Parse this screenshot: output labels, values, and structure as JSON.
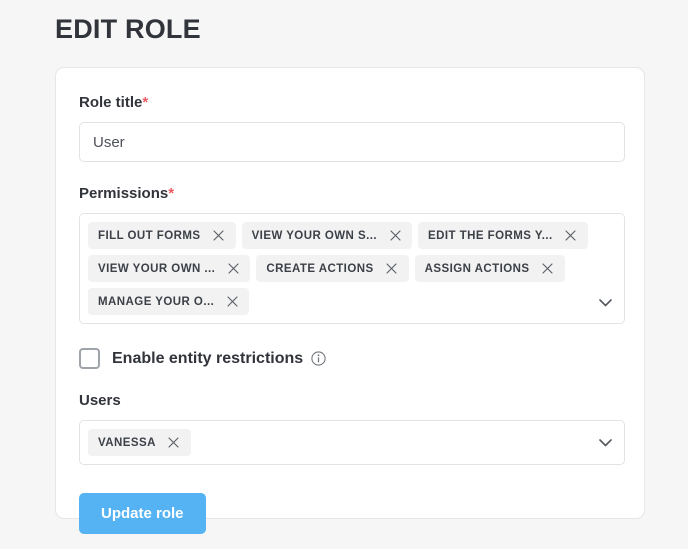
{
  "page": {
    "title": "EDIT ROLE",
    "background_color": "#f6f6f6"
  },
  "form": {
    "role_title": {
      "label": "Role title",
      "required_marker": "*",
      "value": "User",
      "placeholder": "Role title"
    },
    "permissions": {
      "label": "Permissions",
      "required_marker": "*",
      "chips": [
        {
          "label": "FILL OUT FORMS",
          "remove": "×"
        },
        {
          "label": "VIEW YOUR OWN S...",
          "remove": "×"
        },
        {
          "label": "EDIT THE FORMS Y...",
          "remove": "×"
        },
        {
          "label": "VIEW YOUR OWN ...",
          "remove": "×"
        },
        {
          "label": "CREATE ACTIONS",
          "remove": "×"
        },
        {
          "label": "ASSIGN ACTIONS",
          "remove": "×"
        },
        {
          "label": "MANAGE YOUR O...",
          "remove": "×"
        }
      ],
      "caret": "chevron-down"
    },
    "entity_restrictions": {
      "label": "Enable entity restrictions",
      "checked": false,
      "info": "i"
    },
    "users": {
      "label": "Users",
      "chips": [
        {
          "label": "VANESSA",
          "remove": "×"
        }
      ],
      "caret": "chevron-down"
    },
    "submit": {
      "label": "Update role",
      "color": "#55b3f3"
    }
  }
}
